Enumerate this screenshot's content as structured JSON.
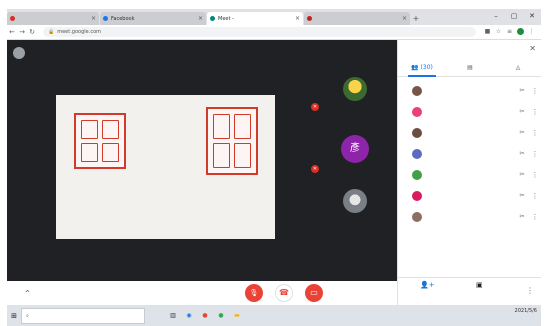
{
  "browser": {
    "tabs": [
      {
        "title": "",
        "active": false,
        "favicon_color": "#d93025"
      },
      {
        "title": "Facebook",
        "active": false,
        "favicon_color": "#1877f2"
      },
      {
        "title": "Meet -",
        "active": true,
        "favicon_color": "#00897b"
      },
      {
        "title": "",
        "active": false,
        "favicon_color": "#c5221f"
      }
    ],
    "new_tab_glyph": "+",
    "address": "meet.google.com",
    "window_controls": [
      "–",
      "▢",
      "✕"
    ]
  },
  "meet": {
    "presenting_text": "",
    "slide": {
      "caption_left": "",
      "caption_right": "",
      "seal_color": "#d23a2c"
    },
    "participants_tiles": [
      {
        "name": "",
        "avatar_color": "#f4b400",
        "mic_muted": true
      },
      {
        "name": "",
        "avatar_letter": "彥",
        "avatar_color": "#8e24aa",
        "mic_muted": true
      },
      {
        "name": "",
        "avatar_color": "#9aa0a6",
        "mic_muted": false
      }
    ],
    "controls": {
      "meeting_details_label": "",
      "meeting_details_glyph": "^",
      "mic_glyph": "🎙",
      "hangup_glyph": "☎",
      "camera_glyph": "▭",
      "accent_red": "#ea4335"
    }
  },
  "side_panel": {
    "title": "",
    "close_glyph": "✕",
    "tabs": [
      {
        "label": "(30)",
        "icon": "people-icon",
        "glyph": "👥"
      },
      {
        "label": "",
        "icon": "chat-icon",
        "glyph": "▤"
      },
      {
        "label": "",
        "icon": "activities-icon",
        "glyph": "◬"
      }
    ],
    "participants": [
      {
        "name": "",
        "avatar_color": "#795548"
      },
      {
        "name": "",
        "avatar_color": "#ec407a"
      },
      {
        "name": "",
        "avatar_color": "#6d4c41"
      },
      {
        "name": "",
        "avatar_color": "#5c6bc0"
      },
      {
        "name": "",
        "avatar_color": "#43a047"
      },
      {
        "name": "",
        "avatar_color": "#d81b60"
      },
      {
        "name": "",
        "avatar_color": "#8d6e63"
      }
    ],
    "footer": {
      "add_label": "",
      "add_glyph": "👤+",
      "present_label": "",
      "present_glyph": "▣",
      "more_glyph": "⋮"
    }
  },
  "taskbar": {
    "search_placeholder": "",
    "start_glyph": "⊞",
    "apps": [
      "▥",
      "◉",
      "●",
      "●",
      "▬"
    ],
    "clock_time": "",
    "clock_date": "2021/5/6"
  }
}
